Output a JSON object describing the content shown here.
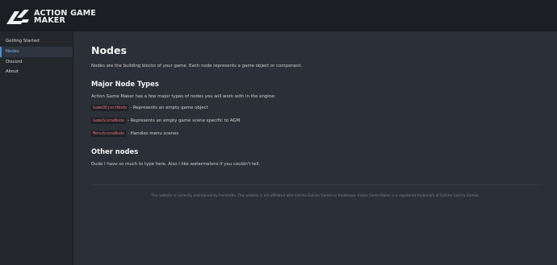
{
  "header": {
    "logo_text": "ACTION GAME MAKER"
  },
  "sidebar": {
    "items": [
      {
        "label": "Getting Started"
      },
      {
        "label": "Nodes"
      },
      {
        "label": "Discord"
      },
      {
        "label": "About"
      }
    ],
    "active_index": 1
  },
  "main": {
    "title": "Nodes",
    "intro": "Nodes are the building blocks of your game. Each node represents a game object or component.",
    "major_heading": "Major Node Types",
    "major_intro": "Action Game Maker has a few major types of nodes you will work with in the engine:",
    "node_types": [
      {
        "name": "GameObjectNode",
        "description": "- Represents an empty game object"
      },
      {
        "name": "GameSceneNode",
        "description": "- Represents an empty game scene specific to AGM"
      },
      {
        "name": "MenuSceneNode",
        "description": "- Handles menu scenes"
      }
    ],
    "other_heading": "Other nodes",
    "other_text": "Dude I have so much to type here. Also I like watermelons if you couldn't tell."
  },
  "footer": {
    "text": "This website is currently maintained by Icemint9x. This website is not affiliated with Gotcha Gotcha Games or Kadokawa. Action Game Maker is a registered trademark of Gotcha Gotcha Games."
  },
  "colors": {
    "header_bg": "#1b1e22",
    "sidebar_bg": "#23272c",
    "main_bg": "#2b2f37",
    "active_accent": "#4a90d9",
    "code_text": "#e06c75"
  }
}
